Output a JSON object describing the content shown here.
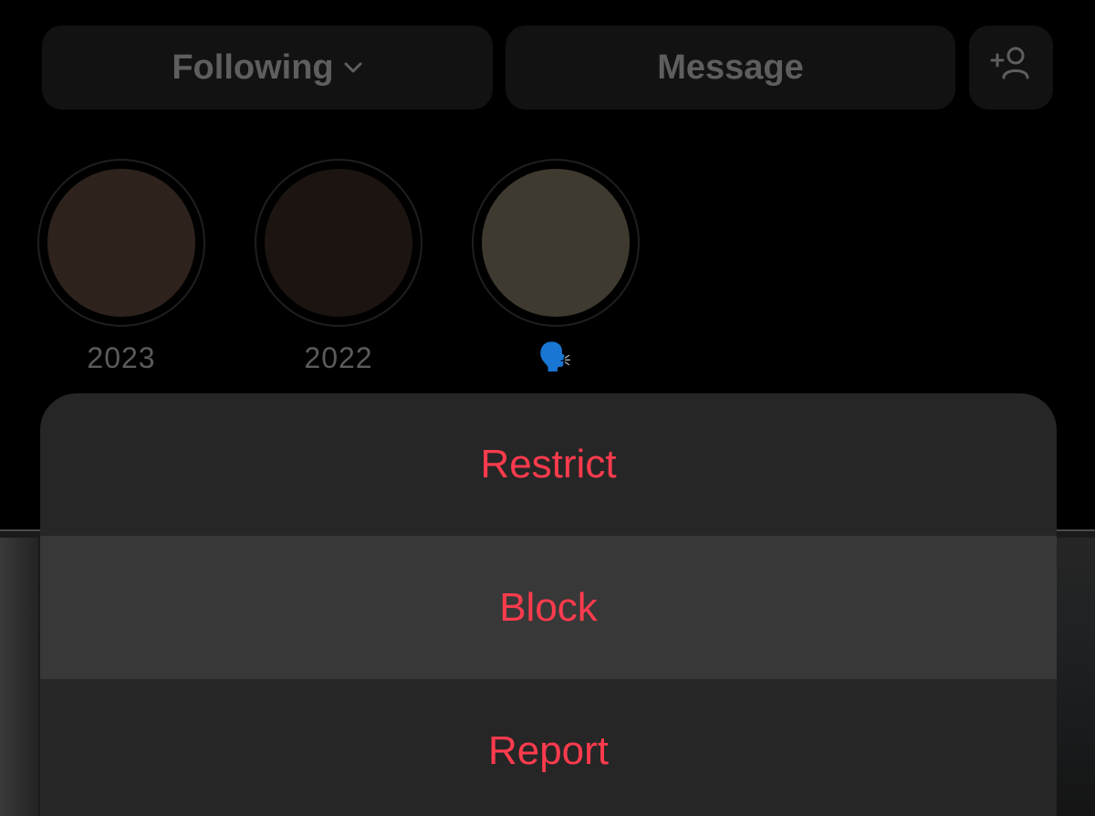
{
  "profile_actions": {
    "following_label": "Following",
    "message_label": "Message"
  },
  "highlights": [
    {
      "label": "2023",
      "cover_color": "#2e231c"
    },
    {
      "label": "2022",
      "cover_color": "#1b1410"
    },
    {
      "label": "🗣️",
      "cover_color": "#3f3a30"
    }
  ],
  "action_sheet": {
    "items": [
      {
        "label": "Restrict"
      },
      {
        "label": "Block"
      },
      {
        "label": "Report"
      }
    ]
  },
  "colors": {
    "destructive": "#ff3b4d",
    "sheet_background": "#262626",
    "sheet_pressed": "#383838",
    "button_background": "#121212"
  }
}
